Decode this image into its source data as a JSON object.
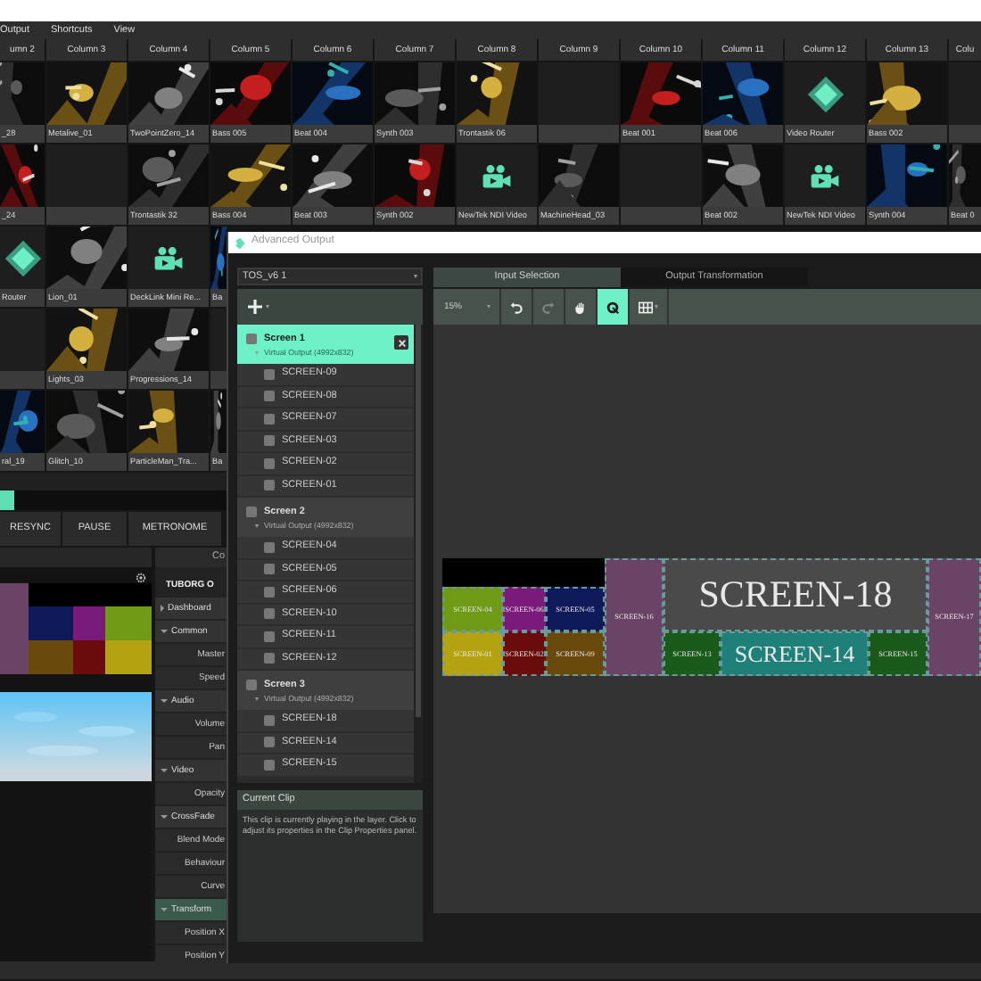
{
  "menu": [
    "Output",
    "Shortcuts",
    "View"
  ],
  "columns": [
    "umn 2",
    "Column 3",
    "Column 4",
    "Column 5",
    "Column 6",
    "Column 7",
    "Column 8",
    "Column 9",
    "Column 10",
    "Column 11",
    "Column 12",
    "Column 13",
    "Colu"
  ],
  "clip_rows": [
    [
      {
        "label": "_28",
        "kind": "picture"
      },
      {
        "label": "Metalive_01",
        "kind": "picture"
      },
      {
        "label": "TwoPointZero_14",
        "kind": "picture"
      },
      {
        "label": "Bass 005",
        "kind": "picture"
      },
      {
        "label": "Beat 004",
        "kind": "picture"
      },
      {
        "label": "Synth 003",
        "kind": "picture"
      },
      {
        "label": "Trontastik 06",
        "kind": "picture"
      },
      {
        "kind": "empty"
      },
      {
        "label": "Beat 001",
        "kind": "picture"
      },
      {
        "label": "Beat 006",
        "kind": "picture"
      },
      {
        "label": "Video Router",
        "kind": "router"
      },
      {
        "label": "Bass 002",
        "kind": "picture"
      },
      {
        "kind": "empty"
      }
    ],
    [
      {
        "label": "_24",
        "kind": "picture"
      },
      {
        "kind": "empty"
      },
      {
        "label": "Trontastik 32",
        "kind": "picture"
      },
      {
        "label": "Bass 004",
        "kind": "picture"
      },
      {
        "label": "Beat 003",
        "kind": "picture"
      },
      {
        "label": "Synth 002",
        "kind": "picture"
      },
      {
        "label": "NewTek NDI Video",
        "kind": "camera"
      },
      {
        "label": "MachineHead_03",
        "kind": "picture"
      },
      {
        "kind": "empty"
      },
      {
        "label": "Beat 002",
        "kind": "picture"
      },
      {
        "label": "NewTek NDI Video",
        "kind": "camera"
      },
      {
        "label": "Synth 004",
        "kind": "picture"
      },
      {
        "label": "Beat 0",
        "kind": "picture"
      }
    ],
    [
      {
        "label": "Router",
        "kind": "router"
      },
      {
        "label": "Lion_01",
        "kind": "picture"
      },
      {
        "label": "DeckLink Mini Re...",
        "kind": "camera"
      },
      {
        "label": "Ba",
        "kind": "picture"
      }
    ],
    [
      {
        "kind": "empty"
      },
      {
        "label": "Lights_03",
        "kind": "picture"
      },
      {
        "label": "Progressions_14",
        "kind": "picture"
      },
      {
        "kind": "empty"
      }
    ],
    [
      {
        "label": "ral_19",
        "kind": "picture"
      },
      {
        "label": "Glitch_10",
        "kind": "picture"
      },
      {
        "label": "ParticleMan_Tra...",
        "kind": "picture"
      },
      {
        "label": "Ba",
        "kind": "picture"
      }
    ]
  ],
  "transport_buttons": [
    "RESYNC",
    "PAUSE",
    "METRONOME"
  ],
  "composition_header": "Co",
  "properties": {
    "title": "TUBORG O",
    "groups": [
      {
        "label": "Dashboard",
        "expanded": false,
        "selected": false
      },
      {
        "label": "Common",
        "expanded": true,
        "selected": false,
        "children": [
          "Master",
          "Speed"
        ]
      },
      {
        "label": "Audio",
        "expanded": true,
        "selected": false,
        "children": [
          "Volume",
          "Pan"
        ]
      },
      {
        "label": "Video",
        "expanded": true,
        "selected": false,
        "children": [
          "Opacity"
        ]
      },
      {
        "label": "CrossFade",
        "expanded": true,
        "selected": false,
        "children": [
          "Blend Mode",
          "Behaviour",
          "Curve"
        ]
      },
      {
        "label": "Transform",
        "expanded": true,
        "selected": true,
        "children": [
          "Position X",
          "Position Y"
        ]
      }
    ]
  },
  "advanced_output": {
    "title": "Advanced Output",
    "preset": "TOS_v6 1",
    "screens": [
      {
        "name": "Screen 1",
        "selected": true,
        "checked": false,
        "device": "Virtual Output (4992x832)",
        "slices": [
          {
            "name": "SCREEN-09",
            "checked": false
          },
          {
            "name": "SCREEN-08",
            "checked": false
          },
          {
            "name": "SCREEN-07",
            "checked": false
          },
          {
            "name": "SCREEN-03",
            "checked": false
          },
          {
            "name": "SCREEN-02",
            "checked": false
          },
          {
            "name": "SCREEN-01",
            "checked": false
          }
        ]
      },
      {
        "name": "Screen 2",
        "selected": false,
        "checked": false,
        "device": "Virtual Output (4992x832)",
        "slices": [
          {
            "name": "SCREEN-04",
            "checked": false
          },
          {
            "name": "SCREEN-05",
            "checked": false
          },
          {
            "name": "SCREEN-06",
            "checked": false
          },
          {
            "name": "SCREEN-10",
            "checked": false
          },
          {
            "name": "SCREEN-11",
            "checked": false
          },
          {
            "name": "SCREEN-12",
            "checked": false
          }
        ]
      },
      {
        "name": "Screen 3",
        "selected": false,
        "checked": false,
        "device": "Virtual Output (4992x832)",
        "slices": [
          {
            "name": "SCREEN-18",
            "checked": false
          },
          {
            "name": "SCREEN-14",
            "checked": false
          },
          {
            "name": "SCREEN-15",
            "checked": false
          }
        ]
      }
    ],
    "current_clip": {
      "title": "Current Clip",
      "text": "This clip is currently playing in the layer. Click to adjust its properties in the Clip Properties panel."
    },
    "tabs": [
      {
        "label": "Input Selection",
        "selected": true
      },
      {
        "label": "Output Transformation",
        "selected": false
      }
    ],
    "zoom": "15%",
    "tools": [
      {
        "kind": "undo",
        "selected": false,
        "disabled": false
      },
      {
        "kind": "redo",
        "selected": false,
        "disabled": true
      },
      {
        "kind": "hand",
        "selected": false,
        "disabled": false
      },
      {
        "kind": "mask",
        "selected": true,
        "disabled": false
      },
      {
        "kind": "grid",
        "selected": false,
        "disabled": false
      }
    ],
    "canvas": {
      "grid": [
        {
          "name": "SCREEN-04",
          "color": "#6e9a16"
        },
        {
          "name": "SCREEN-06",
          "color": "#7a1a7a"
        },
        {
          "name": "SCREEN-05",
          "color": "#0e1a5a"
        },
        {
          "name": "SCREEN-01",
          "color": "#b4a414"
        },
        {
          "name": "SCREEN-02",
          "color": "#6a0c0c"
        },
        {
          "name": "SCREEN-09",
          "color": "#6a4a0c"
        }
      ],
      "side_left": {
        "name": "SCREEN-16",
        "color": "#6a4466"
      },
      "main": {
        "name": "SCREEN-18",
        "color": "#4a4a4a"
      },
      "bottom": [
        {
          "name": "SCREEN-13",
          "color": "#1a5a1a"
        },
        {
          "name": "SCREEN-14",
          "color": "#1f8079"
        },
        {
          "name": "SCREEN-15",
          "color": "#1a5a1a"
        }
      ],
      "side_right": {
        "name": "SCREEN-17",
        "color": "#6a4466"
      }
    }
  }
}
